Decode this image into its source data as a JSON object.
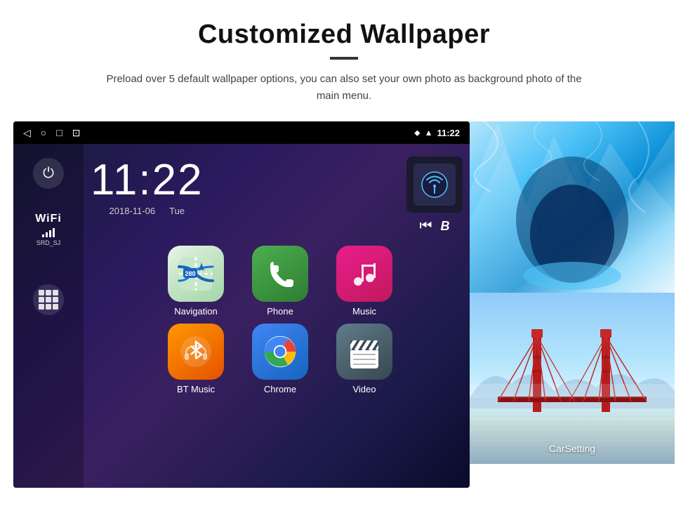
{
  "page": {
    "title": "Customized Wallpaper",
    "divider": true,
    "description": "Preload over 5 default wallpaper options, you can also set your own photo as background photo of the main menu."
  },
  "android": {
    "statusBar": {
      "time": "11:22",
      "navIcons": [
        "◁",
        "○",
        "□",
        "⊡"
      ],
      "rightIcons": [
        "location",
        "wifi",
        "time"
      ]
    },
    "clock": {
      "time": "11:22",
      "date": "2018-11-06",
      "day": "Tue"
    },
    "sidebar": {
      "powerLabel": "⏻",
      "wifiTitle": "WiFi",
      "wifiSSID": "SRD_SJ",
      "appsLabel": "apps"
    },
    "apps": [
      {
        "name": "Navigation",
        "icon": "navigation"
      },
      {
        "name": "Phone",
        "icon": "phone"
      },
      {
        "name": "Music",
        "icon": "music"
      },
      {
        "name": "BT Music",
        "icon": "btmusic"
      },
      {
        "name": "Chrome",
        "icon": "chrome"
      },
      {
        "name": "Video",
        "icon": "video"
      }
    ]
  },
  "wallpapers": {
    "topAlt": "Ice cave wallpaper",
    "bottomAlt": "Golden Gate Bridge wallpaper",
    "carSettingLabel": "CarSetting"
  }
}
